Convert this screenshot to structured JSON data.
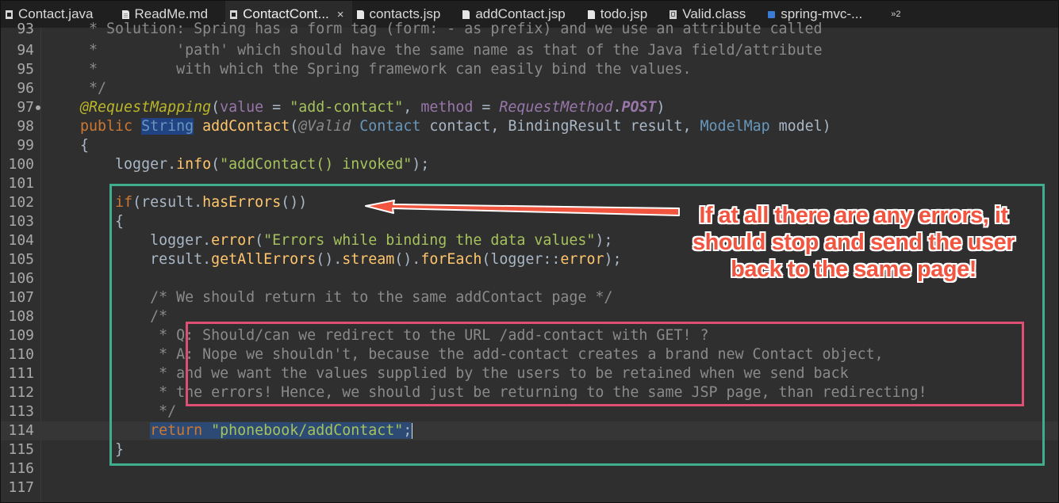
{
  "tabs": [
    {
      "label": "Contact.java",
      "icon": "java-file-icon",
      "active": false
    },
    {
      "label": "ReadMe.md",
      "icon": "markdown-file-icon",
      "active": false
    },
    {
      "label": "ContactCont...",
      "icon": "java-file-icon",
      "active": true,
      "close": "×"
    },
    {
      "label": "contacts.jsp",
      "icon": "jsp-file-icon",
      "active": false
    },
    {
      "label": "addContact.jsp",
      "icon": "jsp-file-icon",
      "active": false
    },
    {
      "label": "todo.jsp",
      "icon": "jsp-file-icon",
      "active": false
    },
    {
      "label": "Valid.class",
      "icon": "class-file-icon",
      "active": false
    },
    {
      "label": "spring-mvc-...",
      "icon": "web-file-icon",
      "active": false
    }
  ],
  "tab_overflow": "»2",
  "lines": {
    "l93": {
      "num": "93",
      "text": "     * Solution: Spring has a form tag (form: - as prefix) and we use an attribute called"
    },
    "l94": {
      "num": "94",
      "text": "     *         'path' which should have the same name as that of the Java field/attribute"
    },
    "l95": {
      "num": "95",
      "text": "     *         with which the Spring framework can easily bind the values."
    },
    "l96": {
      "num": "96",
      "text": "     */"
    },
    "l97": {
      "num": "97",
      "a": "    ",
      "b": "@RequestMapping",
      "c": "(",
      "d": "value",
      "e": " = ",
      "f": "\"add-contact\"",
      "g": ", ",
      "h": "method",
      "i": " = ",
      "j": "RequestMethod",
      "k": ".",
      "l": "POST",
      "m": ")"
    },
    "l98": {
      "num": "98",
      "a": "    ",
      "b": "public",
      "c": " ",
      "d": "String",
      "e": " ",
      "f": "addContact",
      "g": "(",
      "h": "@Valid",
      "i": " ",
      "j": "Contact",
      "k": " contact, BindingResult result, ",
      "l": "ModelMap",
      "m": " model)"
    },
    "l99": {
      "num": "99",
      "text": "    {"
    },
    "l100": {
      "num": "100",
      "a": "        logger.",
      "b": "info",
      "c": "(",
      "d": "\"addContact() invoked\"",
      "e": ");"
    },
    "l101": {
      "num": "101"
    },
    "l102": {
      "num": "102",
      "a": "        ",
      "b": "if",
      "c": "(result.",
      "d": "hasErrors",
      "e": "())"
    },
    "l103": {
      "num": "103",
      "text": "        {"
    },
    "l104": {
      "num": "104",
      "a": "            logger.",
      "b": "error",
      "c": "(",
      "d": "\"Errors while binding the data values\"",
      "e": ");"
    },
    "l105": {
      "num": "105",
      "a": "            result.",
      "b": "getAllErrors",
      "c": "().",
      "d": "stream",
      "e": "().",
      "f": "forEach",
      "g": "(logger::",
      "h": "error",
      "i": ");"
    },
    "l106": {
      "num": "106"
    },
    "l107": {
      "num": "107",
      "text": "            /* We should return it to the same addContact page */"
    },
    "l108": {
      "num": "108",
      "text": "            /*"
    },
    "l109": {
      "num": "109",
      "text": "             * Q: Should/can we redirect to the URL /add-contact with GET! ?"
    },
    "l110": {
      "num": "110",
      "text": "             * A: Nope we shouldn't, because the add-contact creates a brand new Contact object,"
    },
    "l111": {
      "num": "111",
      "text": "             * and we want the values supplied by the users to be retained when we send back"
    },
    "l112": {
      "num": "112",
      "text": "             * the errors! Hence, we should just be returning to the same JSP page, than redirecting!"
    },
    "l113": {
      "num": "113",
      "text": "             */"
    },
    "l114": {
      "num": "114",
      "a": "            ",
      "b": "return",
      "c": " ",
      "d": "\"phonebook/addContact\"",
      "e": ";"
    },
    "l115": {
      "num": "115",
      "text": "        }"
    },
    "l116": {
      "num": "116"
    },
    "l117": {
      "num": "117"
    }
  },
  "callout": {
    "text": "If at all there are any errors, it should stop and send the user back to the same page!"
  },
  "colors": {
    "green_box": "#3fae8f",
    "pink_box": "#de4f73",
    "arrow": "#f2553f",
    "callout_text": "#f2553f"
  }
}
